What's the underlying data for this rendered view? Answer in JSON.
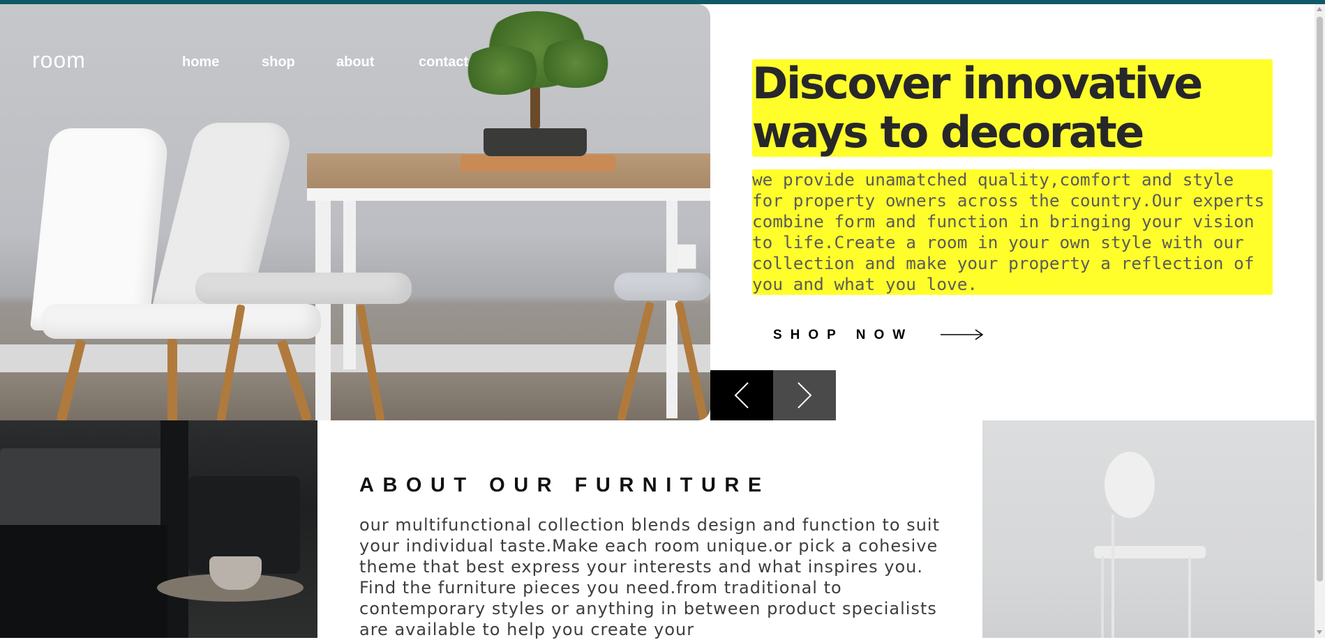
{
  "brand": {
    "logo": "room"
  },
  "nav": {
    "items": [
      "home",
      "shop",
      "about",
      "contact"
    ]
  },
  "hero": {
    "headline": "Discover innovative ways to decorate",
    "text": "we provide unamatched quality,comfort and style for property owners across the country.Our experts combine form and function in bringing your vision to life.Create a room in your own style with our collection and make your property a reflection of you and what you love.",
    "cta": "SHOP NOW",
    "arrow_icon": "long-arrow-right-icon",
    "highlight_color": "#fffe2b"
  },
  "slider": {
    "prev_icon": "chevron-left-icon",
    "next_icon": "chevron-right-icon"
  },
  "about": {
    "title": "ABOUT OUR FURNITURE",
    "text": "our multifunctional collection blends design and function to suit your individual taste.Make each room unique.or pick a cohesive theme that best express your interests and what inspires you. Find the furniture pieces you need.from traditional to contemporary styles or anything in between product specialists are available to help you create your"
  },
  "colors": {
    "top_bar": "#0f5866",
    "text_dark": "#27272a"
  }
}
